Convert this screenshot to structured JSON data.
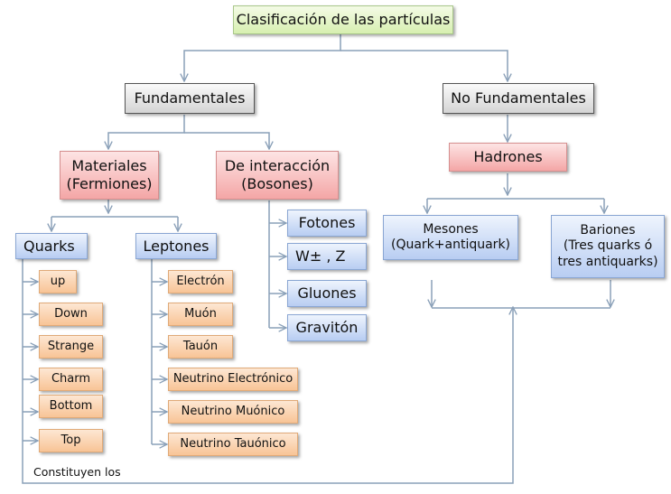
{
  "title": "Clasificación de las partículas",
  "fundamentales": "Fundamentales",
  "no_fundamentales": "No Fundamentales",
  "materiales": {
    "line1": "Materiales",
    "line2": "(Fermiones)"
  },
  "interaccion": {
    "line1": "De interacción",
    "line2": "(Bosones)"
  },
  "hadrones": "Hadrones",
  "mesones": {
    "line1": "Mesones",
    "line2": "(Quark+antiquark)"
  },
  "bariones": {
    "line1": "Bariones",
    "line2": "(Tres quarks ó",
    "line3": "tres antiquarks)"
  },
  "quarks": {
    "label": "Quarks",
    "items": [
      "up",
      "Down",
      "Strange",
      "Charm",
      "Bottom",
      "Top"
    ]
  },
  "leptones": {
    "label": "Leptones",
    "items": [
      "Electrón",
      "Muón",
      "Tauón",
      "Neutrino Electrónico",
      "Neutrino Muónico",
      "Neutrino Tauónico"
    ]
  },
  "bosones": {
    "items": [
      "Fotones",
      "W± , Z",
      "Gluones",
      "Gravitón"
    ]
  },
  "constituyen": "Constituyen los",
  "colors": {
    "line": "#8aa0b8",
    "root_fill": "#e4f4c8",
    "category_fill": "#e0e0e0",
    "subcategory_fill": "#f8c0c0",
    "group_fill": "#cddcf6",
    "leaf_fill": "#fad4b0"
  }
}
